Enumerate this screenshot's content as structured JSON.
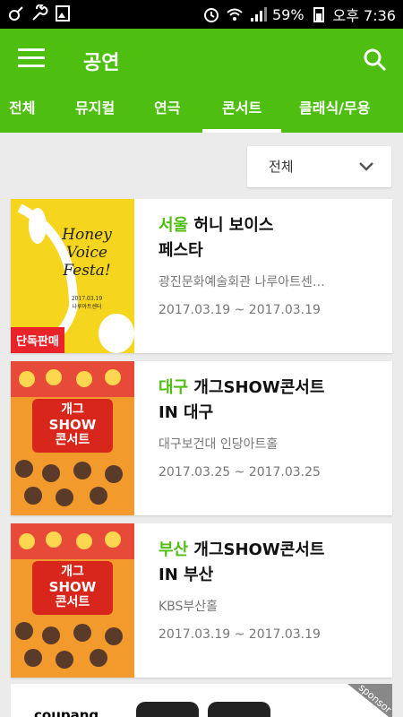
{
  "status_bar": {
    "battery": "59%",
    "time": "오후 7:36"
  },
  "app_bar": {
    "title": "공연",
    "menu_icon": "hamburger-menu-icon",
    "search_icon": "search-icon"
  },
  "tabs": [
    {
      "label": "전체"
    },
    {
      "label": "뮤지컬"
    },
    {
      "label": "연극"
    },
    {
      "label": "콘서트",
      "active": true
    },
    {
      "label": "클래식/무용"
    }
  ],
  "filter": {
    "selected": "전체"
  },
  "cards": [
    {
      "city": "서울",
      "title_line1": " 허니 보이스",
      "title_line2": "페스타",
      "venue": "광진문화예술회관 나루아트센…",
      "dates": "2017.03.19 ~ 2017.03.19",
      "badge": "단독판매",
      "poster_text": [
        "Honey",
        "Voice",
        "Festa!"
      ],
      "poster_small": [
        "2017.03.19",
        "나루아트센터"
      ]
    },
    {
      "city": "대구",
      "title_line1": " 개그SHOW콘서트",
      "title_line2": "IN 대구",
      "venue": "대구보건대 인당아트홀",
      "dates": "2017.03.25 ~ 2017.03.25",
      "poster_text": [
        "개그",
        "SHOW",
        "콘서트"
      ]
    },
    {
      "city": "부산",
      "title_line1": " 개그SHOW콘서트",
      "title_line2": "IN 부산",
      "venue": "KBS부산홀",
      "dates": "2017.03.19 ~ 2017.03.19",
      "poster_text": [
        "개그",
        "SHOW",
        "콘서트"
      ]
    }
  ],
  "ad": {
    "logo": "coupang",
    "corner": "sponsor"
  },
  "colors": {
    "brand_green": "#4ebe11",
    "badge_red": "#e8242a"
  }
}
